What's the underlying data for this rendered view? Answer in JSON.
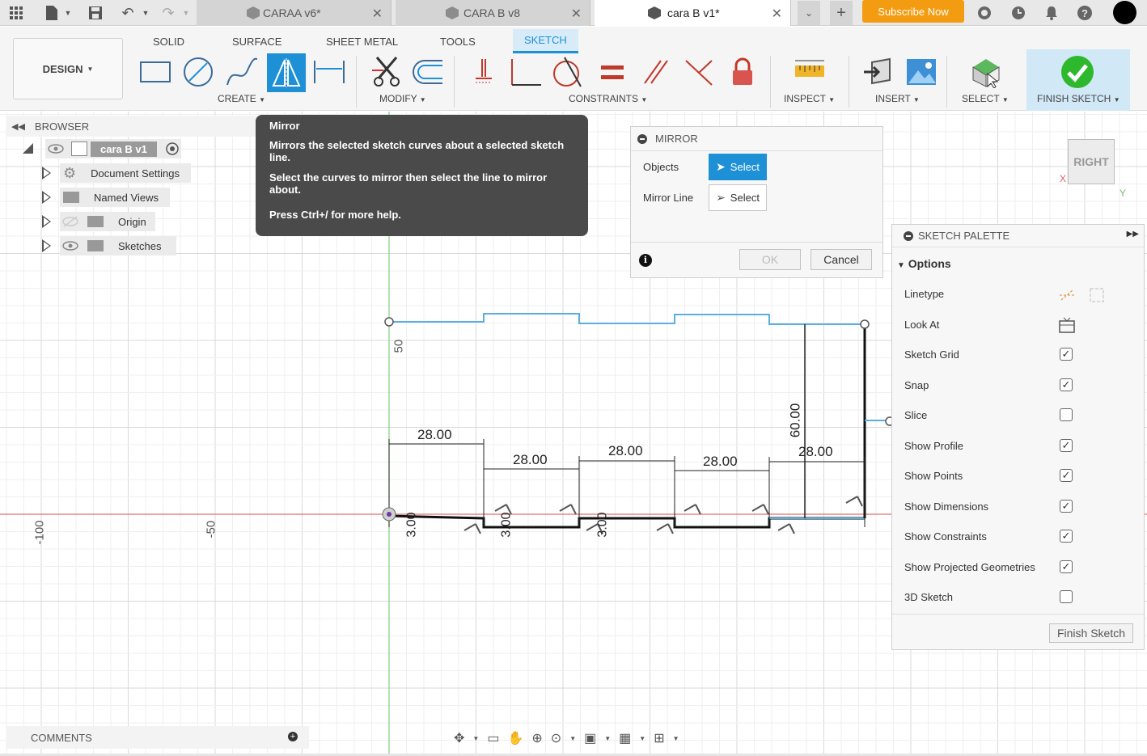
{
  "titlebar": {
    "tabs": [
      {
        "label": "CARAA v6*",
        "active": false
      },
      {
        "label": "CARA B v8",
        "active": false
      },
      {
        "label": "cara B v1*",
        "active": true
      }
    ],
    "subscribe_label": "Subscribe Now"
  },
  "ribbon": {
    "workspace_label": "DESIGN",
    "tabs": [
      "SOLID",
      "SURFACE",
      "SHEET METAL",
      "TOOLS",
      "SKETCH"
    ],
    "active_tab": "SKETCH",
    "groups": {
      "create": "CREATE",
      "modify": "MODIFY",
      "constraints": "CONSTRAINTS",
      "inspect": "INSPECT",
      "insert": "INSERT",
      "select": "SELECT",
      "finish": "FINISH SKETCH"
    }
  },
  "browser": {
    "title": "BROWSER",
    "root": "cara B v1",
    "items": [
      "Document Settings",
      "Named Views",
      "Origin",
      "Sketches"
    ]
  },
  "tooltip": {
    "title": "Mirror",
    "line1": "Mirrors the selected sketch curves about a selected sketch line.",
    "line2": "Select the curves to mirror then select the line to mirror about.",
    "line3": "Press Ctrl+/ for more help."
  },
  "mirror_dialog": {
    "title": "MIRROR",
    "objects_label": "Objects",
    "objects_button": "Select",
    "mirror_line_label": "Mirror Line",
    "mirror_line_button": "Select",
    "ok_label": "OK",
    "cancel_label": "Cancel"
  },
  "viewcube": {
    "face": "RIGHT",
    "axis_x": "X",
    "axis_y": "Y"
  },
  "palette": {
    "title": "SKETCH PALETTE",
    "section": "Options",
    "rows": [
      {
        "label": "Linetype",
        "kind": "icons"
      },
      {
        "label": "Look At",
        "kind": "icon"
      },
      {
        "label": "Sketch Grid",
        "checked": true
      },
      {
        "label": "Snap",
        "checked": true
      },
      {
        "label": "Slice",
        "checked": false
      },
      {
        "label": "Show Profile",
        "checked": true
      },
      {
        "label": "Show Points",
        "checked": true
      },
      {
        "label": "Show Dimensions",
        "checked": true
      },
      {
        "label": "Show Constraints",
        "checked": true
      },
      {
        "label": "Show Projected Geometries",
        "checked": true
      },
      {
        "label": "3D Sketch",
        "checked": false
      }
    ],
    "finish_button": "Finish Sketch"
  },
  "sketch": {
    "axis_labels": [
      "-100",
      "-50",
      "50"
    ],
    "dimensions": [
      "28.00",
      "28.00",
      "28.00",
      "28.00",
      "28.00",
      "60.00",
      "3.00",
      "3.00",
      "3.00"
    ]
  },
  "comments": {
    "label": "COMMENTS"
  },
  "colors": {
    "accent": "#1e90d6",
    "subscribe": "#f39c12",
    "sketch_line": "#5aaee0",
    "axis_red": "#e07070",
    "axis_green": "#7ed07e"
  }
}
